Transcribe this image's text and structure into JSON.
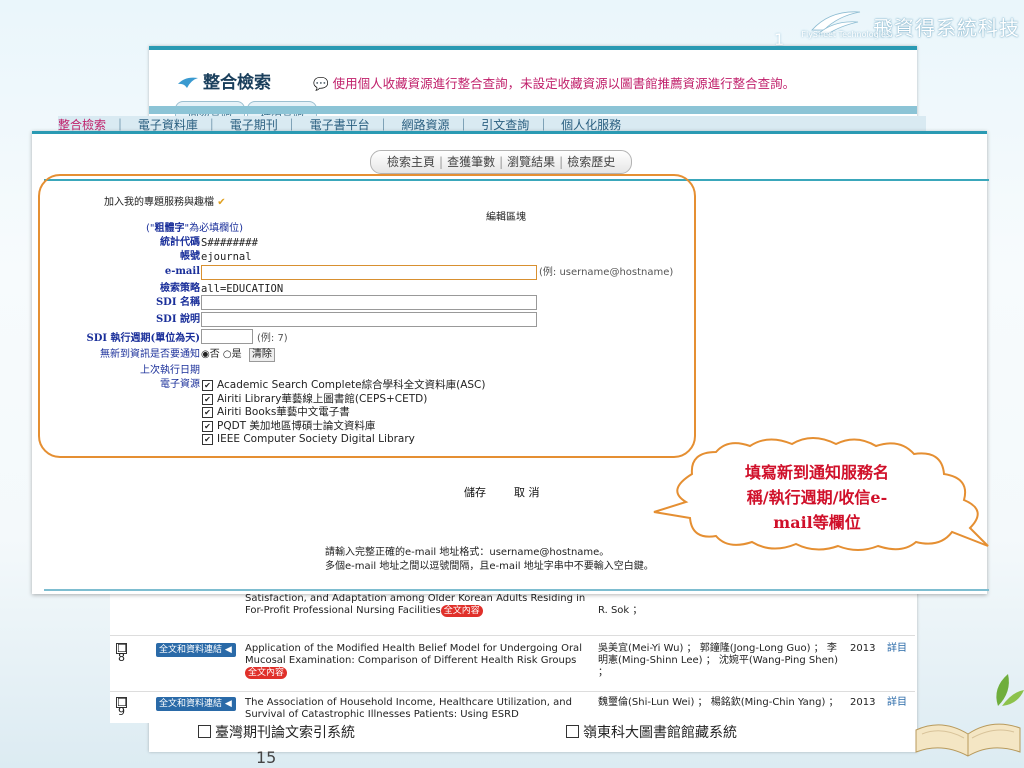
{
  "slide": {
    "brand_name": "飛資得系統科技",
    "brand_logo_text": "FlySheet",
    "brand_logo_sub": "Technologies",
    "page_number_top": "1",
    "page_number_bottom": "15"
  },
  "back_screen": {
    "title": "整合檢索",
    "note": "使用個人收藏資源進行整合查詢，未設定收藏資源以圖書館推薦資源進行整合查詢。",
    "tabs": [
      "簡易查詢",
      "進階查詢"
    ],
    "nav": [
      "整合檢索",
      "電子資料庫",
      "電子期刊",
      "電子書平台",
      "網路資源",
      "引文查詢",
      "個人化服務"
    ],
    "nav_separator": "｜",
    "results": [
      {
        "num": "",
        "badge": "",
        "title": "Satisfaction, and Adaptation among Older Korean Adults Residing in For-Profit Professional Nursing Facilities",
        "fulltext": "全文內容",
        "authors": "R. Sok ；",
        "year": "",
        "detail": ""
      },
      {
        "num": "8",
        "badge": "全文和資料連結",
        "title": "Application of the Modified Health Belief Model for Undergoing Oral Mucosal Examination: Comparison of Different Health Risk Groups",
        "fulltext": "全文內容",
        "authors": "吳美宜(Mei-Yi Wu) ； 郭鐘隆(Jong-Long Guo) ； 李明憲(Ming-Shinn Lee) ； 沈婉平(Wang-Ping Shen) ；",
        "year": "2013",
        "detail": "詳目"
      },
      {
        "num": "9",
        "badge": "全文和資料連結",
        "title": "The Association of Household Income, Healthcare Utilization, and Survival of Catastrophic Illnesses Patients: Using ESRD",
        "fulltext": "",
        "authors": "魏璽倫(Shi-Lun Wei) ； 楊銘欽(Ming-Chin Yang) ；",
        "year": "2013",
        "detail": "詳目"
      }
    ],
    "footer_left": "臺灣期刊論文索引系統",
    "footer_right": "嶺東科大圖書館館藏系統"
  },
  "form": {
    "tabs": [
      "檢索主頁",
      "查獲筆數",
      "瀏覽結果",
      "檢索歷史"
    ],
    "tab_separator": "|",
    "add_service": "加入我的專題服務與趣檔",
    "edit_area": "編輯區塊",
    "required_note_pre": "(\"",
    "required_note_bold": "粗體字",
    "required_note_post": "\"為必填欄位)",
    "fields": {
      "stat_code_label": "統計代碼",
      "stat_code_value": "S########",
      "account_label": "帳號",
      "account_value": "ejournal",
      "email_label": "e-mail",
      "email_value": "",
      "email_example": "(例: username@hostname)",
      "strategy_label": "檢索策略",
      "strategy_value": "all=EDUCATION",
      "sdi_name_label": "SDI 名稱",
      "sdi_desc_label": "SDI 說明",
      "sdi_period_label": "SDI 執行週期(單位為天)",
      "sdi_period_example": "(例: 7)",
      "notify_label": "無新到資訊是否要通知",
      "notify_no": "否",
      "notify_yes": "是",
      "clear_label": "清除",
      "last_run_label": "上次執行日期",
      "resources_label": "電子資源"
    },
    "resources": [
      "Academic Search Complete綜合學科全文資料庫(ASC)",
      "Airiti Library華藝線上圖書館(CEPS+CETD)",
      "Airiti Books華藝中文電子書",
      "PQDT 美加地區博碩士論文資料庫",
      "IEEE Computer Society Digital Library"
    ],
    "save_label": "儲存",
    "cancel_label": "取 消",
    "hint1": "請輸入完整正確的e-mail 地址格式：username@hostname。",
    "hint2": "多個e-mail 地址之間以逗號間隔，且e-mail 地址字串中不要輸入空白鍵。"
  },
  "callout": {
    "line1": "填寫新到通知服務名",
    "line2": "稱/執行週期/收信e-",
    "line3": "mail等欄位"
  },
  "colors": {
    "highlight": "#e58f32",
    "callout_text": "#d0102a",
    "label": "#1a2f9a",
    "accent": "#2a9ab3"
  }
}
